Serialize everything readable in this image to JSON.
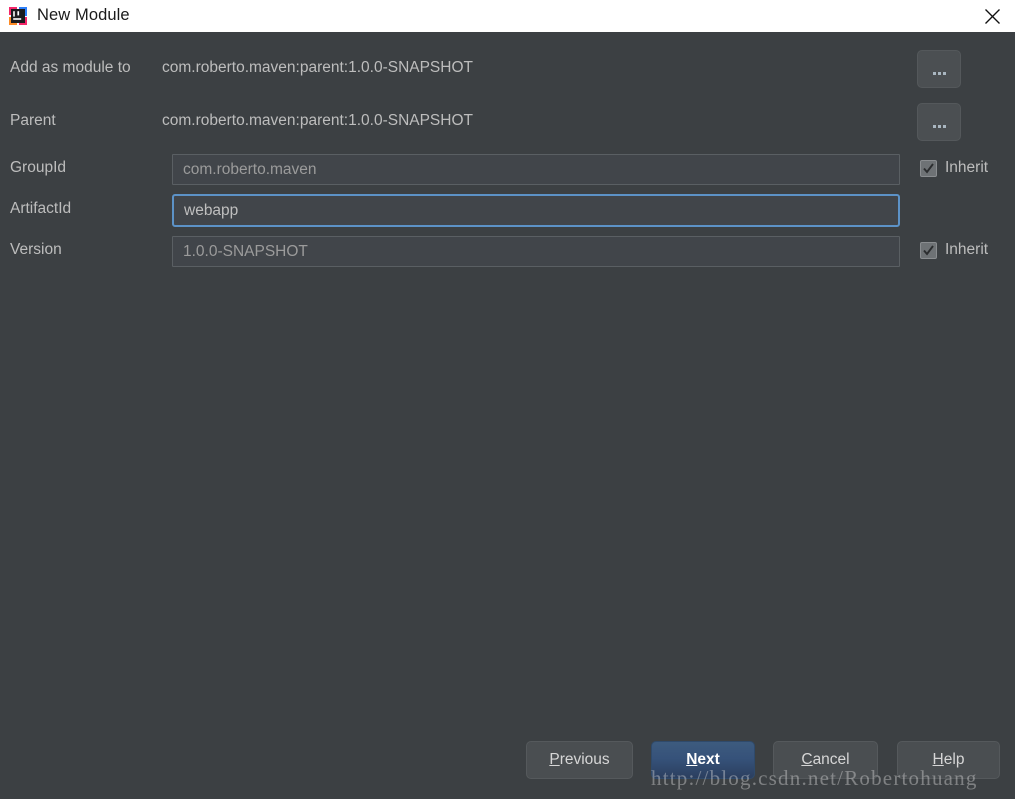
{
  "window": {
    "title": "New Module",
    "app_icon": "intellij-idea-icon",
    "close_icon": "close-icon",
    "titlebar_bg": "#ffffff",
    "body_bg": "#3c4043"
  },
  "form": {
    "rows": [
      {
        "label": "Add as module to",
        "value": "com.roberto.maven:parent:1.0.0-SNAPSHOT",
        "browse_label": "..."
      },
      {
        "label": "Parent",
        "value": "com.roberto.maven:parent:1.0.0-SNAPSHOT",
        "browse_label": "..."
      }
    ],
    "fields": [
      {
        "label": "GroupId",
        "value": "com.roberto.maven",
        "focused": false,
        "inherit_label": "Inherit",
        "inherit_checked": true
      },
      {
        "label": "ArtifactId",
        "value": "webapp",
        "focused": true,
        "inherit_label": "",
        "inherit_checked": false
      },
      {
        "label": "Version",
        "value": "1.0.0-SNAPSHOT",
        "focused": false,
        "inherit_label": "Inherit",
        "inherit_checked": true
      }
    ]
  },
  "footer": {
    "buttons": [
      {
        "mnemonic": "P",
        "rest": "revious",
        "default": false
      },
      {
        "mnemonic": "N",
        "rest": "ext",
        "default": true
      },
      {
        "mnemonic": "C",
        "rest": "ancel",
        "default": false
      },
      {
        "mnemonic": "H",
        "rest": "elp",
        "default": false
      }
    ]
  },
  "watermark": {
    "text": "http://blog.csdn.net/Robertohuang"
  },
  "colors": {
    "focus_border": "#5c92c7",
    "default_button": "#36527a",
    "text": "#bdbdbd",
    "field_text": "#9b9b9b"
  }
}
